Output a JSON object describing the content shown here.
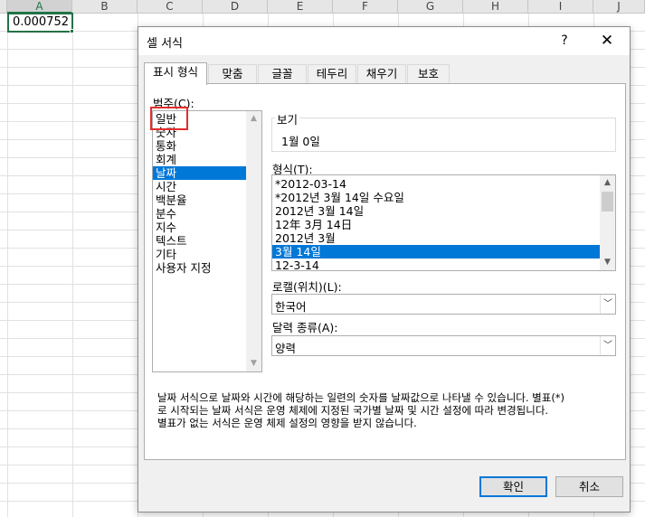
{
  "sheet": {
    "columns": [
      "A",
      "B",
      "C",
      "D",
      "E",
      "F",
      "G",
      "H",
      "I",
      "J"
    ],
    "selected_column": "A",
    "cell_a1_value": "0.000752"
  },
  "dialog": {
    "title": "셀 서식",
    "help": "?",
    "close": "✕",
    "tabs": [
      "표시 형식",
      "맞춤",
      "글꼴",
      "테두리",
      "채우기",
      "보호"
    ],
    "active_tab": "표시 형식",
    "category": {
      "label": "범주(C):",
      "items": [
        "일반",
        "숫자",
        "통화",
        "회계",
        "날짜",
        "시간",
        "백분율",
        "분수",
        "지수",
        "텍스트",
        "기타",
        "사용자 지정"
      ],
      "selected": "날짜",
      "highlighted_annotation": "일반"
    },
    "sample": {
      "label": "보기",
      "value": "1월 0일"
    },
    "type": {
      "label": "형식(T):",
      "items": [
        "*2012-03-14",
        "*2012년 3월 14일 수요일",
        "2012년 3월 14일",
        "12年 3月 14日",
        "2012년 3월",
        "3월 14일",
        "12-3-14"
      ],
      "selected": "3월 14일"
    },
    "locale": {
      "label": "로캘(위치)(L):",
      "value": "한국어"
    },
    "calendar": {
      "label": "달력 종류(A):",
      "value": "양력"
    },
    "description": [
      "날짜 서식으로 날짜와 시간에 해당하는 일련의 숫자를 날짜값으로 나타낼 수 있습니다. 별표(*)",
      "로 시작되는 날짜 서식은 운영 체제에 지정된 국가별 날짜 및 시간 설정에 따라 변경됩니다.",
      "별표가 없는 서식은 운영 체제 설정의 영향을 받지 않습니다."
    ],
    "ok_label": "확인",
    "cancel_label": "취소"
  },
  "colors": {
    "accent": "#0078d7",
    "annotation": "#e32d2d",
    "excel_green": "#217346"
  }
}
